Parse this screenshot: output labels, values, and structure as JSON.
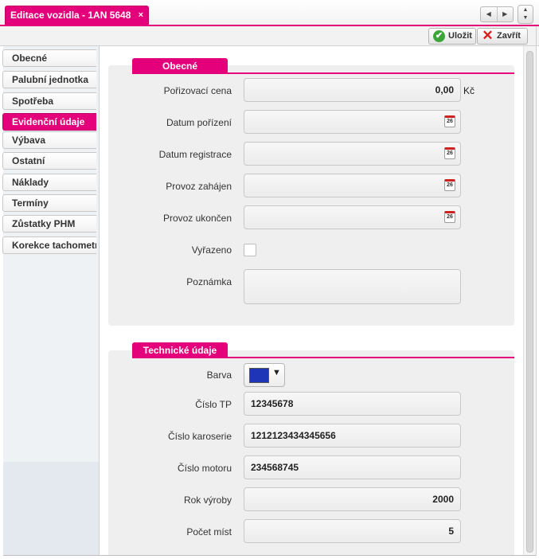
{
  "tab": {
    "title": "Editace vozidla - 1AN 5648",
    "close_glyph": "×"
  },
  "nav_arrows": {
    "prev": "◀",
    "next": "▶",
    "up": "▲",
    "down": "▼"
  },
  "toolbar": {
    "save_label": "Uložit",
    "close_label": "Zavřít"
  },
  "sidebar": {
    "items": [
      {
        "label": "Obecné",
        "active": false
      },
      {
        "label": "Palubní jednotka",
        "active": false
      },
      {
        "label": "Spotřeba",
        "active": false
      },
      {
        "label": "Evidenční údaje",
        "active": true
      },
      {
        "label": "Výbava",
        "active": false
      },
      {
        "label": "Ostatní",
        "active": false
      },
      {
        "label": "Náklady",
        "active": false
      },
      {
        "label": "Termíny",
        "active": false
      },
      {
        "label": "Zůstatky PHM",
        "active": false
      },
      {
        "label": "Korekce tachometru",
        "active": false
      }
    ]
  },
  "general": {
    "title": "Obecné",
    "purchase_price": {
      "label": "Pořizovací cena",
      "value": "0,00",
      "unit": "Kč"
    },
    "purchase_date": {
      "label": "Datum pořízení",
      "value": ""
    },
    "registration_date": {
      "label": "Datum registrace",
      "value": ""
    },
    "operation_started": {
      "label": "Provoz zahájen",
      "value": ""
    },
    "operation_ended": {
      "label": "Provoz ukončen",
      "value": ""
    },
    "retired": {
      "label": "Vyřazeno",
      "checked": false
    },
    "note": {
      "label": "Poznámka",
      "value": ""
    },
    "calendar_day": "26"
  },
  "technical": {
    "title": "Technické údaje",
    "color": {
      "label": "Barva",
      "value": "#1f35b8"
    },
    "tp_number": {
      "label": "Číslo TP",
      "value": "12345678"
    },
    "body_number": {
      "label": "Číslo karoserie",
      "value": "1212123434345656"
    },
    "engine_number": {
      "label": "Číslo motoru",
      "value": "234568745"
    },
    "year": {
      "label": "Rok výroby",
      "value": "2000"
    },
    "seats": {
      "label": "Počet míst",
      "value": "5"
    }
  },
  "colors": {
    "accent": "#e3007a",
    "save_icon": "#3da53a",
    "close_icon": "#d91c1c"
  },
  "icons": {
    "save": "check-circle-icon",
    "close": "x-icon",
    "calendar": "calendar-icon"
  }
}
